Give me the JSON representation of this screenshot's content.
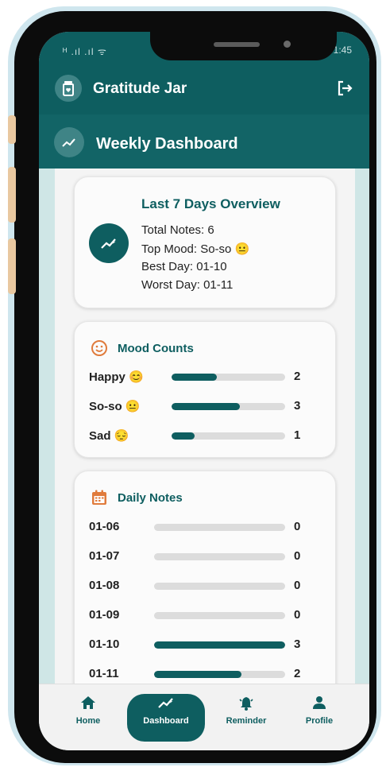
{
  "status_bar": {
    "left": "ᴴ .ıl .ıl ᯤ",
    "right": "% ▭ 1:45"
  },
  "app": {
    "title": "Gratitude Jar",
    "icon": "jar-icon",
    "logout_icon": "logout-icon"
  },
  "section": {
    "title": "Weekly Dashboard",
    "icon": "trend-icon"
  },
  "overview": {
    "title": "Last 7 Days Overview",
    "total_notes": "Total Notes: 6",
    "top_mood": "Top Mood: So-so 😐",
    "best_day": "Best Day: 01-10",
    "worst_day": "Worst Day: 01-11"
  },
  "mood_counts": {
    "title": "Mood Counts",
    "icon": "smile-icon",
    "max": 5,
    "rows": [
      {
        "label": "Happy 😊",
        "count": "2",
        "value": 2
      },
      {
        "label": "So-so 😐",
        "count": "3",
        "value": 3
      },
      {
        "label": "Sad 😔",
        "count": "1",
        "value": 1
      }
    ]
  },
  "daily_notes": {
    "title": "Daily Notes",
    "icon": "calendar-icon",
    "max": 3,
    "rows": [
      {
        "date": "01-06",
        "count": "0",
        "value": 0
      },
      {
        "date": "01-07",
        "count": "0",
        "value": 0
      },
      {
        "date": "01-08",
        "count": "0",
        "value": 0
      },
      {
        "date": "01-09",
        "count": "0",
        "value": 0
      },
      {
        "date": "01-10",
        "count": "3",
        "value": 3
      },
      {
        "date": "01-11",
        "count": "2",
        "value": 2
      }
    ]
  },
  "nav": [
    {
      "label": "Home",
      "icon": "home-icon",
      "active": false
    },
    {
      "label": "Dashboard",
      "icon": "trend-icon",
      "active": true
    },
    {
      "label": "Reminder",
      "icon": "bell-icon",
      "active": false
    },
    {
      "label": "Profile",
      "icon": "person-icon",
      "active": false
    }
  ],
  "colors": {
    "primary": "#0e5e60",
    "track": "#dcdcdc",
    "accent": "#e07b3c"
  }
}
